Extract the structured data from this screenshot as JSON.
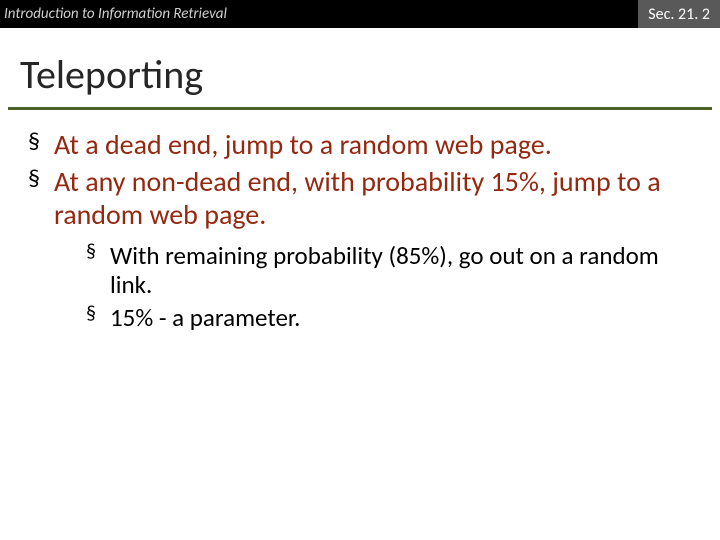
{
  "header": {
    "left": "Introduction to Information Retrieval",
    "right": "Sec. 21. 2"
  },
  "title": "Teleporting",
  "bullets": {
    "b1": "At a dead end, jump to a random web page.",
    "b2": "At any non-dead end, with probability 15%, jump to a random web page.",
    "s1": "With remaining probability (85%), go out on a random link.",
    "s2": "15% - a parameter."
  },
  "glyph": "§"
}
